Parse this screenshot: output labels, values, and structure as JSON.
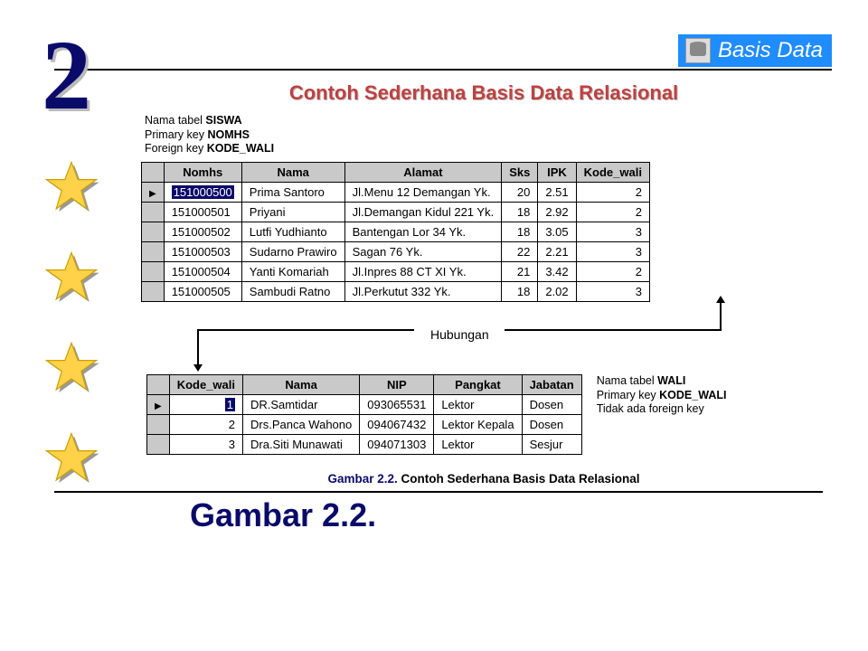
{
  "chapter_number": "2",
  "top_title": "Basis Data",
  "heading": "Contoh Sederhana Basis Data Relasional",
  "table1_meta": {
    "line1_label": "Nama tabel ",
    "line1_value": "SISWA",
    "line2_label": "Primary key ",
    "line2_value": "NOMHS",
    "line3_label": "Foreign key ",
    "line3_value": "KODE_WALI"
  },
  "table1": {
    "headers": [
      "Nomhs",
      "Nama",
      "Alamat",
      "Sks",
      "IPK",
      "Kode_wali"
    ],
    "rows": [
      {
        "pointer": true,
        "cells": [
          "151000500",
          "Prima Santoro",
          "Jl.Menu 12 Demangan Yk.",
          "20",
          "2.51",
          "2"
        ],
        "highlight_first": true
      },
      {
        "pointer": false,
        "cells": [
          "151000501",
          "Priyani",
          "Jl.Demangan Kidul 221 Yk.",
          "18",
          "2.92",
          "2"
        ]
      },
      {
        "pointer": false,
        "cells": [
          "151000502",
          "Lutfi Yudhianto",
          "Bantengan Lor 34 Yk.",
          "18",
          "3.05",
          "3"
        ]
      },
      {
        "pointer": false,
        "cells": [
          "151000503",
          "Sudarno Prawiro",
          "Sagan 76 Yk.",
          "22",
          "2.21",
          "3"
        ]
      },
      {
        "pointer": false,
        "cells": [
          "151000504",
          "Yanti Komariah",
          "Jl.Inpres 88 CT XI Yk.",
          "21",
          "3.42",
          "2"
        ]
      },
      {
        "pointer": false,
        "cells": [
          "151000505",
          "Sambudi Ratno",
          "Jl.Perkutut 332 Yk.",
          "18",
          "2.02",
          "3"
        ]
      }
    ],
    "numeric_cols": [
      3,
      4,
      5
    ]
  },
  "relation_label": "Hubungan",
  "table2_meta": {
    "line1_label": "Nama tabel ",
    "line1_value": "WALI",
    "line2_label": "Primary key ",
    "line2_value": "KODE_WALI",
    "line3": "Tidak ada foreign key"
  },
  "table2": {
    "headers": [
      "Kode_wali",
      "Nama",
      "NIP",
      "Pangkat",
      "Jabatan"
    ],
    "rows": [
      {
        "pointer": true,
        "cells": [
          "1",
          "DR.Samtidar",
          "093065531",
          "Lektor",
          "Dosen"
        ],
        "highlight_first": true,
        "first_numeric": true
      },
      {
        "pointer": false,
        "cells": [
          "2",
          "Drs.Panca Wahono",
          "094067432",
          "Lektor Kepala",
          "Dosen"
        ],
        "first_numeric": true
      },
      {
        "pointer": false,
        "cells": [
          "3",
          "Dra.Siti Munawati",
          "094071303",
          "Lektor",
          "Sesjur"
        ],
        "first_numeric": true
      }
    ],
    "numeric_cols": [
      0
    ]
  },
  "figure_caption_bold": "Gambar 2.2. ",
  "figure_caption_rest": "Contoh Sederhana Basis Data Relasional",
  "big_caption": "Gambar 2.2."
}
